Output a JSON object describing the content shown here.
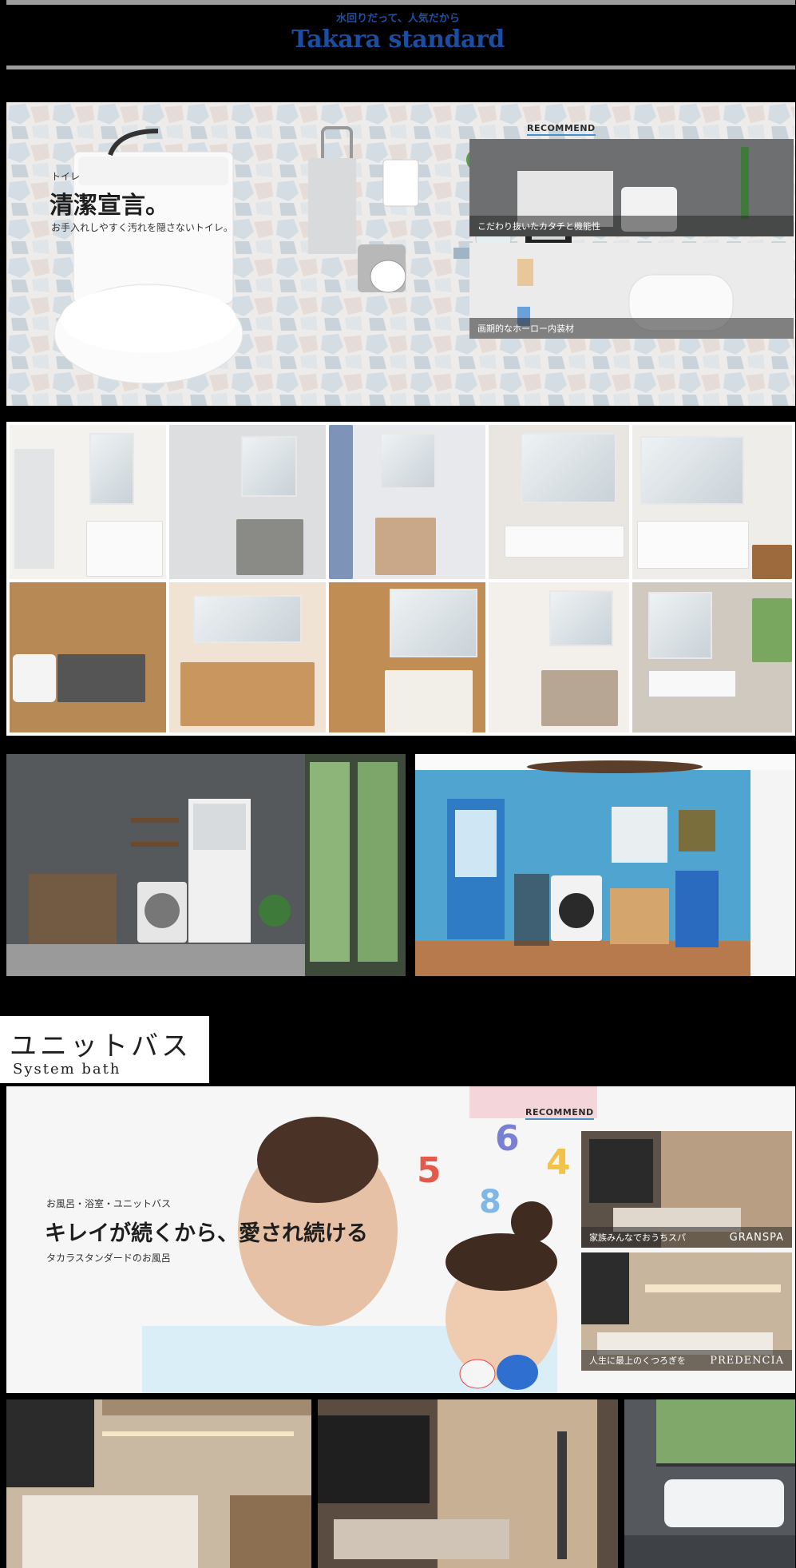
{
  "header": {
    "tagline": "水回りだって、人気だから",
    "brand": "Takara standard"
  },
  "toilet": {
    "category": "トイレ",
    "headline": "清潔宣言。",
    "subtext": "お手入れしやすく汚れを隠さないトイレ。",
    "recommend_label": "RECOMMEND",
    "cards": [
      {
        "caption": "こだわり抜いたカタチと機能性"
      },
      {
        "caption": "画期的なホーロー内装材"
      }
    ]
  },
  "vanity_grid": {
    "rows": 2,
    "cols": 5
  },
  "system_bath": {
    "title_jp": "ユニットバス",
    "title_en": "System bath",
    "category": "お風呂・浴室・ユニットバス",
    "headline": "キレイが続くから、愛され続ける",
    "subtext": "タカラスタンダードのお風呂",
    "recommend_label": "RECOMMEND",
    "toy_numbers": [
      "6",
      "5",
      "4",
      "8"
    ],
    "cards": [
      {
        "caption": "家族みんなでおうちスパ",
        "product": "GRANSPA"
      },
      {
        "caption": "人生に最上のくつろぎを",
        "product": "PREDENCIA"
      }
    ]
  },
  "colors": {
    "brand_blue": "#1a4ea3",
    "divider": "#9c9c9c",
    "recommend_underline": "#4a90c9"
  }
}
